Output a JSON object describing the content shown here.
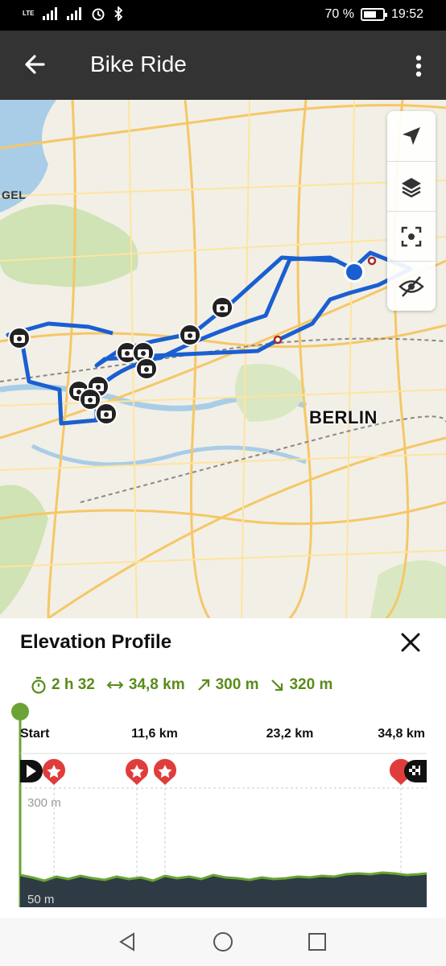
{
  "status": {
    "network": "LTE",
    "battery": "70 %",
    "battery_level": 0.7,
    "time": "19:52"
  },
  "app_bar": {
    "title": "Bike Ride",
    "back_icon": "arrow-back-icon",
    "menu_icon": "more-vert-icon"
  },
  "map": {
    "city_label": "BERLIN",
    "edge_label": "GEL",
    "controls": [
      "navigation-arrow-icon",
      "layers-icon",
      "focus-icon",
      "hide-icon"
    ]
  },
  "elevation": {
    "title": "Elevation Profile",
    "close_icon": "close-icon",
    "stats": {
      "duration": "2 h 32",
      "distance": "34,8 km",
      "ascent": "300 m",
      "descent": "320 m"
    },
    "distance_ticks": [
      "Start",
      "11,6 km",
      "23,2 km",
      "34,8 km"
    ],
    "elevation_labels": [
      "300 m",
      "50 m"
    ],
    "colors": {
      "accent": "#6aa434",
      "stat_text": "#5a8c1a",
      "marker": "#e03c3c",
      "profile_fill": "#2e3b44"
    }
  },
  "nav": {
    "back_icon": "triangle-back-icon",
    "home_icon": "circle-home-icon",
    "recents_icon": "square-recents-icon"
  }
}
